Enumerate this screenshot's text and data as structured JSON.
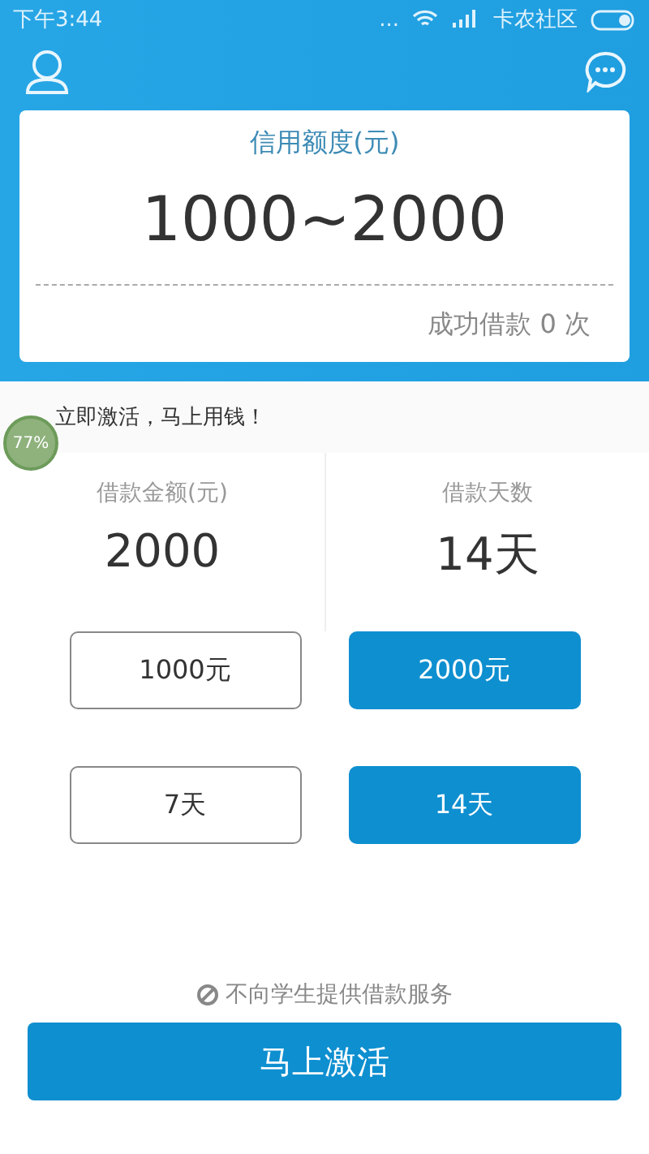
{
  "status_bar": {
    "time": "下午3:44",
    "dots": "...",
    "carrier": "卡农社区"
  },
  "credit_card": {
    "title": "信用额度(元)",
    "range": "1000~2000",
    "borrow_count": "成功借款 0 次"
  },
  "notice": "立即激活，马上用钱！",
  "floating_ball": "77%",
  "summary": [
    {
      "label": "借款金额(元)",
      "value": "2000"
    },
    {
      "label": "借款天数",
      "value": "14天"
    }
  ],
  "amount_options": [
    {
      "label": "1000元",
      "selected": false
    },
    {
      "label": "2000元",
      "selected": true
    }
  ],
  "day_options": [
    {
      "label": "7天",
      "selected": false
    },
    {
      "label": "14天",
      "selected": true
    }
  ],
  "disclaimer": "不向学生提供借款服务",
  "activate_button": "马上激活"
}
